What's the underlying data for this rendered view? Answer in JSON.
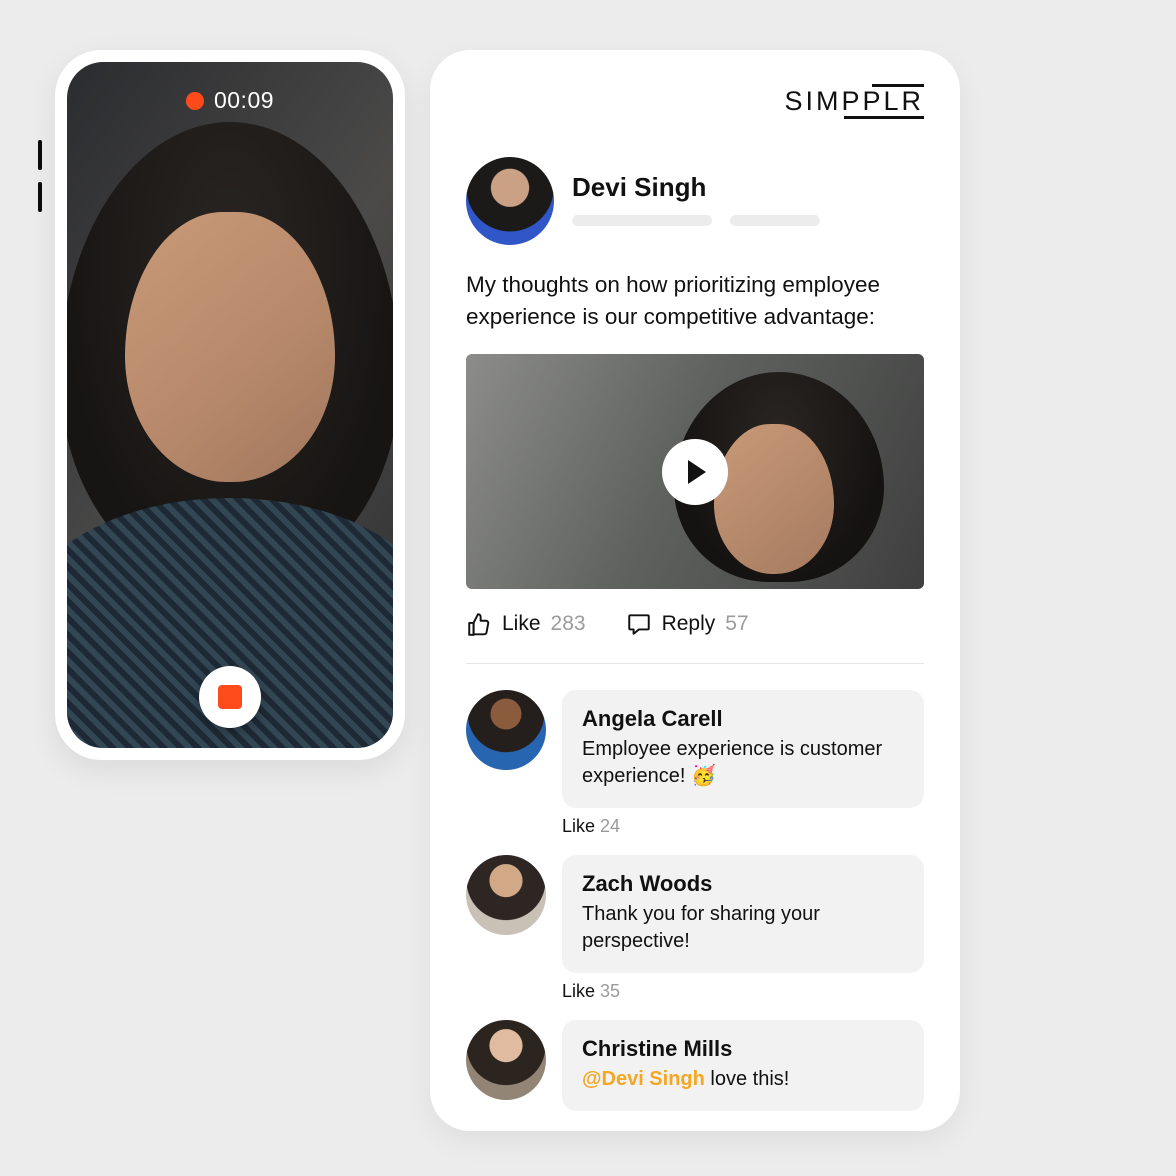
{
  "brand": "SIMPPLR",
  "recording": {
    "time": "00:09"
  },
  "post": {
    "author_name": "Devi Singh",
    "body": "My thoughts on how prioritizing employee experience is our competitive advantage:",
    "like_label": "Like",
    "like_count": "283",
    "reply_label": "Reply",
    "reply_count": "57"
  },
  "comments": [
    {
      "name": "Angela Carell",
      "text": "Employee experience is customer experience! 🥳",
      "like_label": "Like",
      "like_count": "24"
    },
    {
      "name": "Zach Woods",
      "text": "Thank you for sharing your perspective!",
      "like_label": "Like",
      "like_count": "35"
    },
    {
      "name": "Christine Mills",
      "mention": "@Devi Singh",
      "text": " love this!"
    }
  ]
}
